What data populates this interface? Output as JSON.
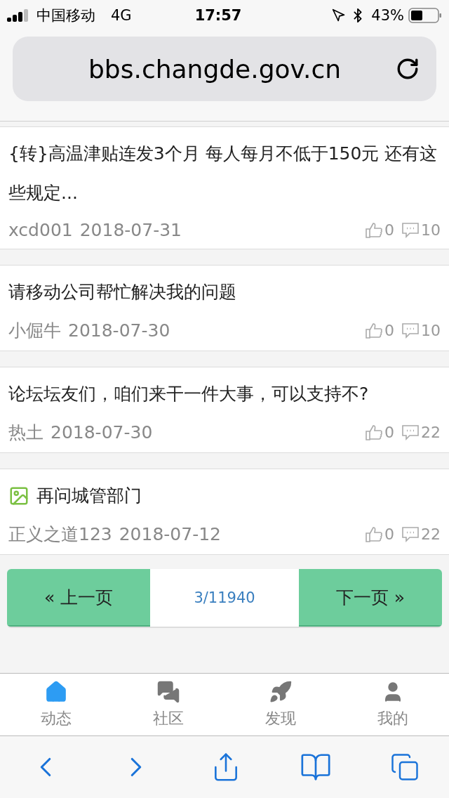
{
  "status_bar": {
    "carrier": "中国移动",
    "network": "4G",
    "time": "17:57",
    "battery": "43%"
  },
  "address_bar": {
    "url": "bbs.changde.gov.cn"
  },
  "posts": [
    {
      "title": "{转}高温津贴连发3个月 每人每月不低于150元 还有这些规定...",
      "has_image": false,
      "author": "xcd001",
      "date": "2018-07-31",
      "likes": "0",
      "comments": "10"
    },
    {
      "title": "请移动公司帮忙解决我的问题",
      "has_image": false,
      "author": "小倔牛",
      "date": "2018-07-30",
      "likes": "0",
      "comments": "10"
    },
    {
      "title": "论坛坛友们，咱们来干一件大事，可以支持不?",
      "has_image": false,
      "author": "热土",
      "date": "2018-07-30",
      "likes": "0",
      "comments": "22"
    },
    {
      "title": "再问城管部门",
      "has_image": true,
      "author": "正义之道123",
      "date": "2018-07-12",
      "likes": "0",
      "comments": "22"
    }
  ],
  "pagination": {
    "prev": "« 上一页",
    "page": "3/11940",
    "next": "下一页 »"
  },
  "tab_bar": [
    {
      "kind": "home",
      "label": "动态",
      "selected": true
    },
    {
      "kind": "chat",
      "label": "社区",
      "selected": false
    },
    {
      "kind": "rocket",
      "label": "发现",
      "selected": false
    },
    {
      "kind": "user",
      "label": "我的",
      "selected": false
    }
  ]
}
